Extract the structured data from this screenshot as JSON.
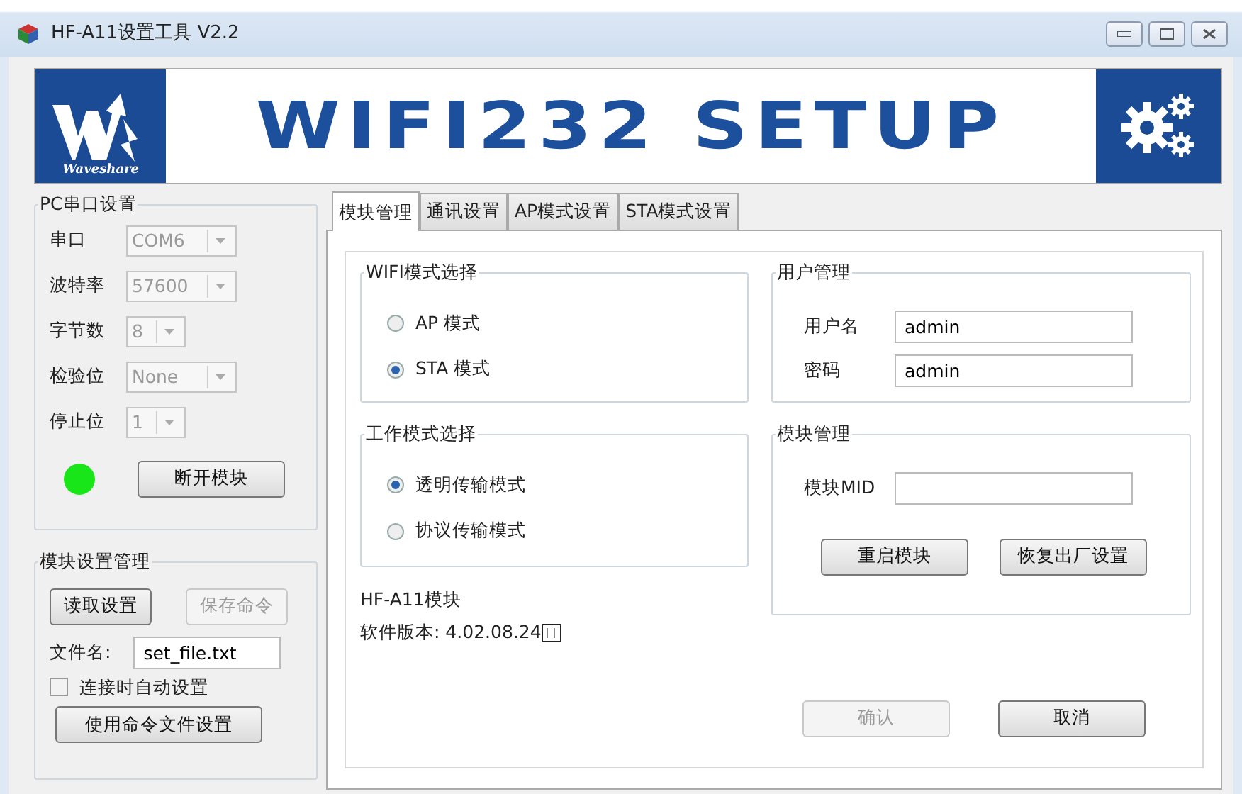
{
  "window": {
    "title": "HF-A11设置工具 V2.2"
  },
  "banner": {
    "logo_text": "Waveshare",
    "title": "WIFI232 SETUP"
  },
  "serial_group": {
    "title": "PC串口设置",
    "fields": [
      {
        "label": "串口",
        "value": "COM6",
        "disabled": true,
        "kind": "wide"
      },
      {
        "label": "波特率",
        "value": "57600",
        "disabled": true,
        "kind": "wide"
      },
      {
        "label": "字节数",
        "value": "8",
        "disabled": true,
        "kind": "narrow"
      },
      {
        "label": "检验位",
        "value": "None",
        "disabled": true,
        "kind": "wide"
      },
      {
        "label": "停止位",
        "value": "1",
        "disabled": true,
        "kind": "narrow"
      }
    ],
    "connected": true,
    "button": "断开模块"
  },
  "module_group": {
    "title": "模块设置管理",
    "buttons": [
      {
        "label": "读取设置",
        "disabled": false
      },
      {
        "label": "保存命令",
        "disabled": true
      }
    ],
    "file_label": "文件名:",
    "file_value": "set_file.txt",
    "auto_setup": {
      "label": "连接时自动设置",
      "checked": false
    },
    "apply_button": "使用命令文件设置"
  },
  "tabs": [
    {
      "label": "模块管理",
      "selected": true
    },
    {
      "label": "通讯设置",
      "selected": false
    },
    {
      "label": "AP模式设置",
      "selected": false
    },
    {
      "label": "STA模式设置",
      "selected": false
    }
  ],
  "wifi_mode": {
    "title": "WIFI模式选择",
    "options": [
      {
        "label": "AP 模式",
        "selected": false
      },
      {
        "label": "STA 模式",
        "selected": true
      }
    ]
  },
  "work_mode": {
    "title": "工作模式选择",
    "options": [
      {
        "label": "透明传输模式",
        "selected": true
      },
      {
        "label": "协议传输模式",
        "selected": false
      }
    ]
  },
  "module_info": {
    "name": "HF-A11模块",
    "version": "软件版本: 4.02.08.24"
  },
  "user": {
    "title": "用户管理",
    "fields": [
      {
        "label": "用户名",
        "value": "admin"
      },
      {
        "label": "密码",
        "value": "admin"
      }
    ]
  },
  "module_mgmt": {
    "title": "模块管理",
    "mid_label": "模块MID",
    "buttons": [
      {
        "label": "重启模块",
        "disabled": false
      },
      {
        "label": "恢复出厂设置",
        "disabled": false
      }
    ]
  },
  "footer_buttons": [
    {
      "label": "确认",
      "disabled": true
    },
    {
      "label": "取消",
      "disabled": false
    }
  ]
}
